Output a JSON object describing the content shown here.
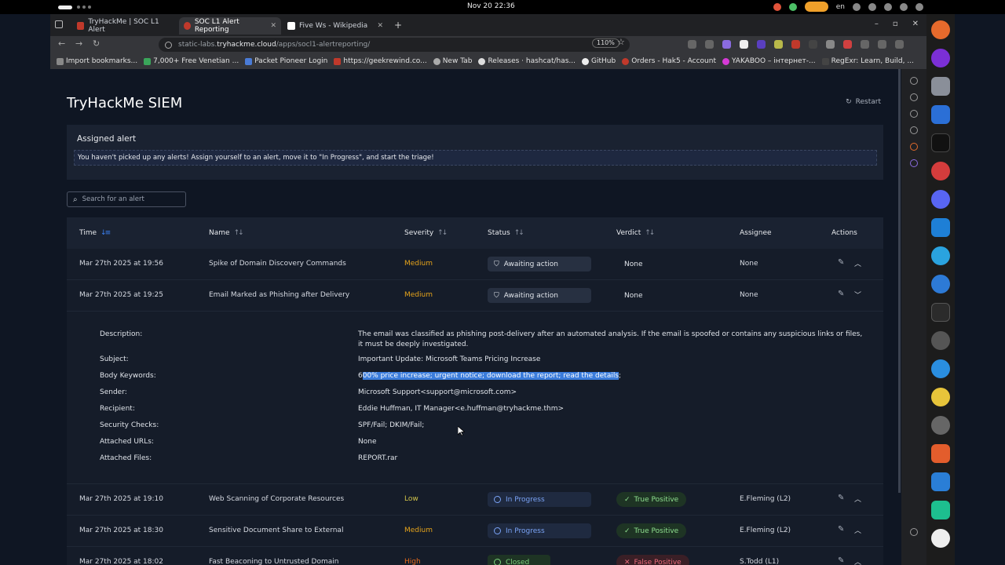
{
  "system": {
    "clock": "Nov 20  22:36",
    "lang": "en"
  },
  "browser": {
    "tabs": [
      {
        "title": "TryHackMe | SOC L1 Alert"
      },
      {
        "title": "SOC L1 Alert Reporting"
      },
      {
        "title": "Five Ws - Wikipedia"
      }
    ],
    "url_host": "static-labs.",
    "url_domain": "tryhackme.cloud",
    "url_path": "/apps/socl1-alertreporting/",
    "zoom": "110%",
    "bookmarks": [
      "Import bookmarks...",
      "7,000+ Free Venetian ...",
      "Packet Pioneer Login",
      "https://geekrewind.co...",
      "New Tab",
      "Releases · hashcat/has...",
      "GitHub",
      "Orders - Hak5 - Account",
      "YAKABOO – інтернет-...",
      "RegExr: Learn, Build, ..."
    ]
  },
  "page": {
    "title": "TryHackMe SIEM",
    "restart": "Restart",
    "assigned_heading": "Assigned alert",
    "assigned_message": "You haven't picked up any alerts! Assign yourself to an alert, move it to \"In Progress\", and start the triage!",
    "search_placeholder": "Search for an alert"
  },
  "table": {
    "headers": {
      "time": "Time",
      "name": "Name",
      "severity": "Severity",
      "status": "Status",
      "verdict": "Verdict",
      "assignee": "Assignee",
      "actions": "Actions"
    },
    "rows": [
      {
        "time": "Mar 27th 2025 at 19:56",
        "name": "Spike of Domain Discovery Commands",
        "severity": "Medium",
        "status": "Awaiting action",
        "verdict": "None",
        "assignee": "None"
      },
      {
        "time": "Mar 27th 2025 at 19:25",
        "name": "Email Marked as Phishing after Delivery",
        "severity": "Medium",
        "status": "Awaiting action",
        "verdict": "None",
        "assignee": "None"
      },
      {
        "time": "Mar 27th 2025 at 19:10",
        "name": "Web Scanning of Corporate Resources",
        "severity": "Low",
        "status": "In Progress",
        "verdict": "True Positive",
        "assignee": "E.Fleming (L2)"
      },
      {
        "time": "Mar 27th 2025 at 18:30",
        "name": "Sensitive Document Share to External",
        "severity": "Medium",
        "status": "In Progress",
        "verdict": "True Positive",
        "assignee": "E.Fleming (L2)"
      },
      {
        "time": "Mar 27th 2025 at 18:02",
        "name": "Fast Beaconing to Untrusted Domain",
        "severity": "High",
        "status": "Closed",
        "verdict": "False Positive",
        "assignee": "S.Todd (L1)"
      }
    ]
  },
  "details": {
    "labels": {
      "description": "Description:",
      "subject": "Subject:",
      "body_keywords": "Body Keywords:",
      "sender": "Sender:",
      "recipient": "Recipient:",
      "security_checks": "Security Checks:",
      "attached_urls": "Attached URLs:",
      "attached_files": "Attached Files:"
    },
    "values": {
      "description": "The email was classified as phishing post-delivery after an automated analysis. If the email is spoofed or contains any suspicious links or files, it must be deeply investigated.",
      "subject": "Important Update: Microsoft Teams Pricing Increase",
      "body_keywords_first": "6",
      "body_keywords_selected": "00% price increase; urgent notice; download the report; read the details",
      "body_keywords_last": ";",
      "sender": "Microsoft Support<support@microsoft.com>",
      "recipient": "Eddie Huffman, IT Manager<e.huffman@tryhackme.thm>",
      "security_checks": "SPF/Fail; DKIM/Fail;",
      "attached_urls": "None",
      "attached_files": "REPORT.rar"
    }
  },
  "colors": {
    "page_bg": "#0f1623",
    "panel_bg": "#1a2231",
    "medium": "#e5a31b",
    "low": "#d1c34a",
    "high": "#e5691b",
    "true_positive": "#8fe08f",
    "false_positive": "#ea6a7a",
    "in_progress": "#7aa3f5",
    "highlight": "#3b7cdb"
  }
}
